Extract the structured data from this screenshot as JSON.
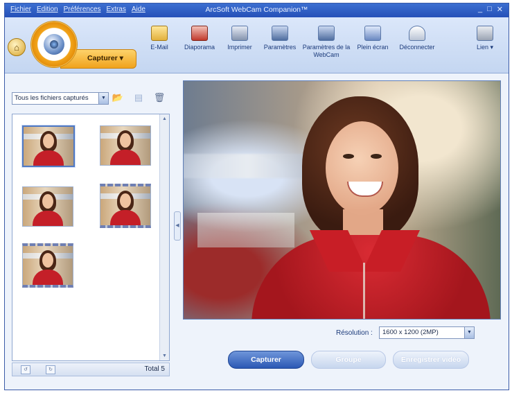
{
  "menu": [
    "Fichier",
    "Edition",
    "Préférences",
    "Extras",
    "Aide"
  ],
  "app_title": "ArcSoft WebCam Companion™",
  "window_controls": {
    "minimize": "_",
    "maximize": "□",
    "close": "✕"
  },
  "capture_tab_label": "Capturer ▾",
  "toolbar": [
    {
      "label": "E-Mail",
      "icon": "email-icon"
    },
    {
      "label": "Diaporama",
      "icon": "slideshow-icon"
    },
    {
      "label": "Imprimer",
      "icon": "printer-icon"
    },
    {
      "label": "Paramètres",
      "icon": "settings-icon"
    },
    {
      "label": "Paramètres de la WebCam",
      "icon": "webcam-settings-icon"
    },
    {
      "label": "Plein écran",
      "icon": "fullscreen-icon"
    },
    {
      "label": "Déconnecter",
      "icon": "disconnect-icon"
    },
    {
      "label": "Lien ▾",
      "icon": "link-icon"
    }
  ],
  "filter": {
    "value": "Tous les fichiers capturés"
  },
  "thumbnails": [
    {
      "selected": true,
      "filmstrip": false
    },
    {
      "selected": false,
      "filmstrip": false
    },
    {
      "selected": false,
      "filmstrip": false
    },
    {
      "selected": false,
      "filmstrip": true
    },
    {
      "selected": false,
      "filmstrip": true
    }
  ],
  "footer": {
    "total": "Total 5"
  },
  "resolution": {
    "label": "Résolution :",
    "value": "1600 x 1200 (2MP)"
  },
  "buttons": {
    "capture": "Capturer",
    "burst": "Groupe",
    "record_video": "Enregistrer vidéo"
  }
}
